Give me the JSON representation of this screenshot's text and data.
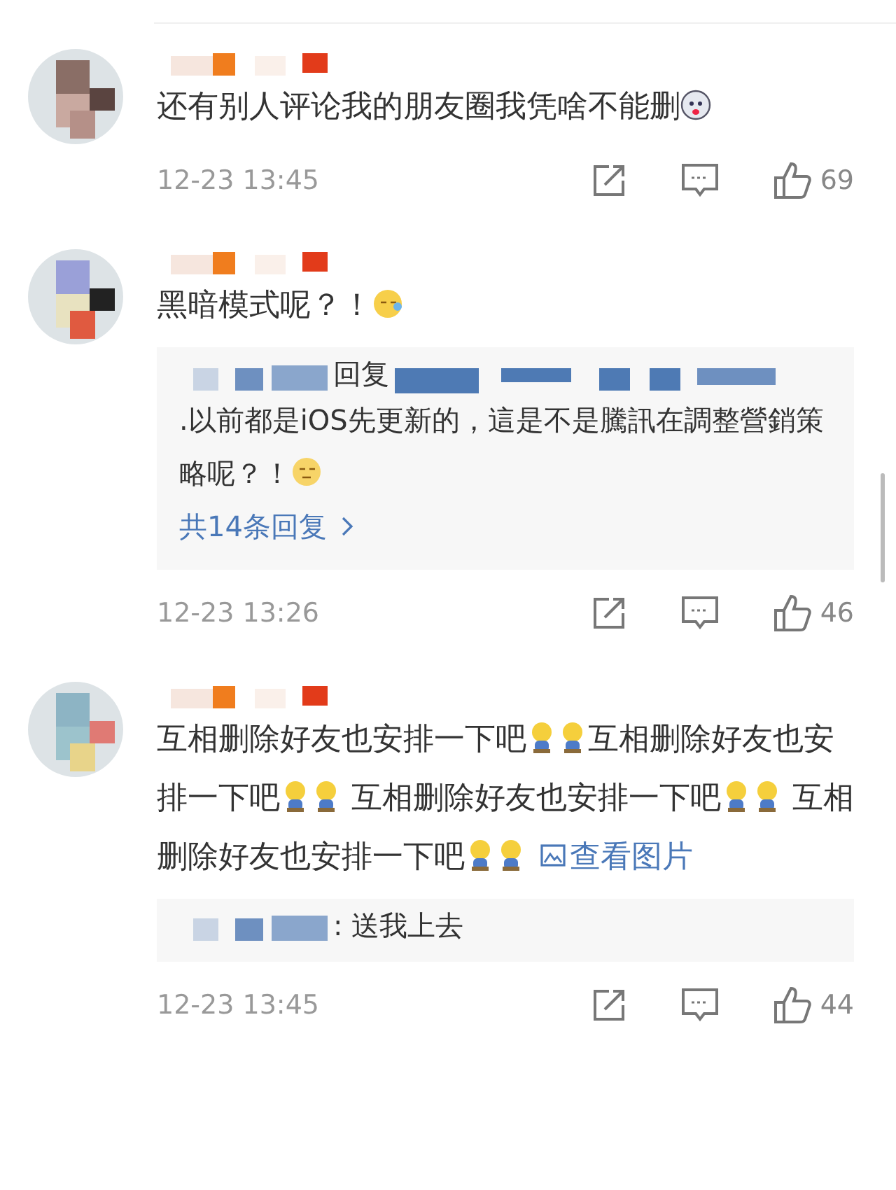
{
  "comments": [
    {
      "segments": [
        {
          "kind": "text",
          "text": "还有别人评论我的朋友圈我凭啥不能删"
        },
        {
          "kind": "dog"
        }
      ],
      "time": "12-23 13:45",
      "likes": "69"
    },
    {
      "segments": [
        {
          "kind": "text",
          "text": "黑暗模式呢？！"
        },
        {
          "kind": "sweat"
        }
      ],
      "replies": {
        "items": [
          {
            "head": "回复",
            "segments": [
              {
                "kind": "text",
                "text": ".以前都是iOS先更新的，這是不是騰訊在調整營銷策略呢？！"
              },
              {
                "kind": "smirk"
              }
            ]
          }
        ],
        "more": "共14条回复"
      },
      "time": "12-23 13:26",
      "likes": "46"
    },
    {
      "segments": [
        {
          "kind": "text",
          "text": "互相删除好友也安排一下吧"
        },
        {
          "kind": "figure"
        },
        {
          "kind": "figure"
        },
        {
          "kind": "text",
          "text": "互相删除好友也安排一下吧"
        },
        {
          "kind": "figure"
        },
        {
          "kind": "figure"
        },
        {
          "kind": "text",
          "text": " 互相删除好友也安排一下吧"
        },
        {
          "kind": "figure"
        },
        {
          "kind": "figure"
        },
        {
          "kind": "text",
          "text": " 互相删除好友也安排一下吧"
        },
        {
          "kind": "figure"
        },
        {
          "kind": "figure"
        }
      ],
      "link": "查看图片",
      "replies": {
        "items": [
          {
            "head": ": 送我上去"
          }
        ]
      },
      "time": "12-23 13:45",
      "likes": "44"
    }
  ]
}
